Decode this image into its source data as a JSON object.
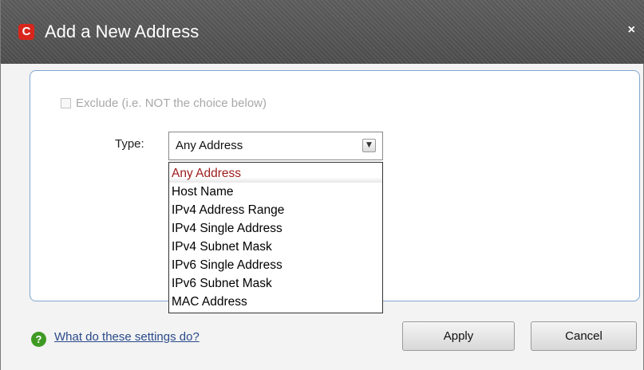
{
  "window": {
    "title": "Add a New Address",
    "logo_letter": "C",
    "close_symbol": "×"
  },
  "form": {
    "exclude_label": "Exclude (i.e. NOT the choice below)",
    "exclude_checked": false,
    "type_label": "Type:",
    "type_value": "Any Address",
    "type_options": [
      "Any Address",
      "Host Name",
      "IPv4 Address Range",
      "IPv4 Single Address",
      "IPv4 Subnet Mask",
      "IPv6 Single Address",
      "IPv6 Subnet Mask",
      "MAC Address"
    ]
  },
  "footer": {
    "help_icon": "question-icon",
    "help_link": "What do these settings do?",
    "apply_label": "Apply",
    "cancel_label": "Cancel"
  },
  "colors": {
    "titlebar": "#575757",
    "logo": "#d9261c",
    "selected_option_text": "#9d1b1b",
    "panel_border": "#7fa7d0",
    "help_icon": "#3f9a24"
  }
}
